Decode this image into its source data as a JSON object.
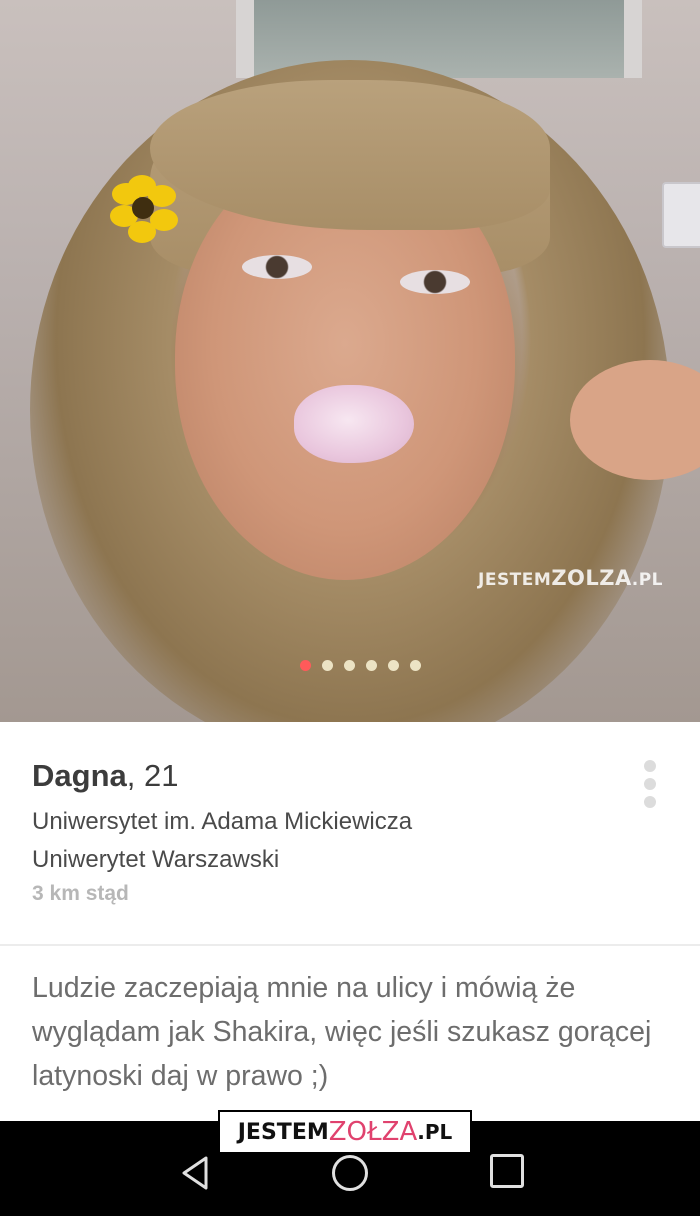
{
  "photo": {
    "watermark_prefix": "JESTEM",
    "watermark_brand": "ZOLZA",
    "watermark_suffix": ".PL",
    "page_count": 6,
    "active_page": 1,
    "active_dot_color": "#ff5a5a",
    "inactive_dot_color": "#ece3c4"
  },
  "profile": {
    "name": "Dagna",
    "age": ", 21",
    "school_1": "Uniwersytet im. Adama Mickiewicza",
    "school_2": "Uniwerytet Warszawski",
    "distance": "3 km stąd",
    "more_icon": "vertical-dots-icon"
  },
  "bio": {
    "text": "Ludzie zaczepiają mnie na ulicy i mówią że wyglądam jak Shakira, więc jeśli szukasz gorącej latynoski daj w prawo ;)"
  },
  "logo": {
    "prefix": "JESTEM",
    "brand": "ZOŁZA",
    "suffix": ".PL"
  },
  "navbar": {
    "back_icon": "back-triangle-icon",
    "home_icon": "home-circle-icon",
    "recent_icon": "recent-apps-square-icon"
  }
}
